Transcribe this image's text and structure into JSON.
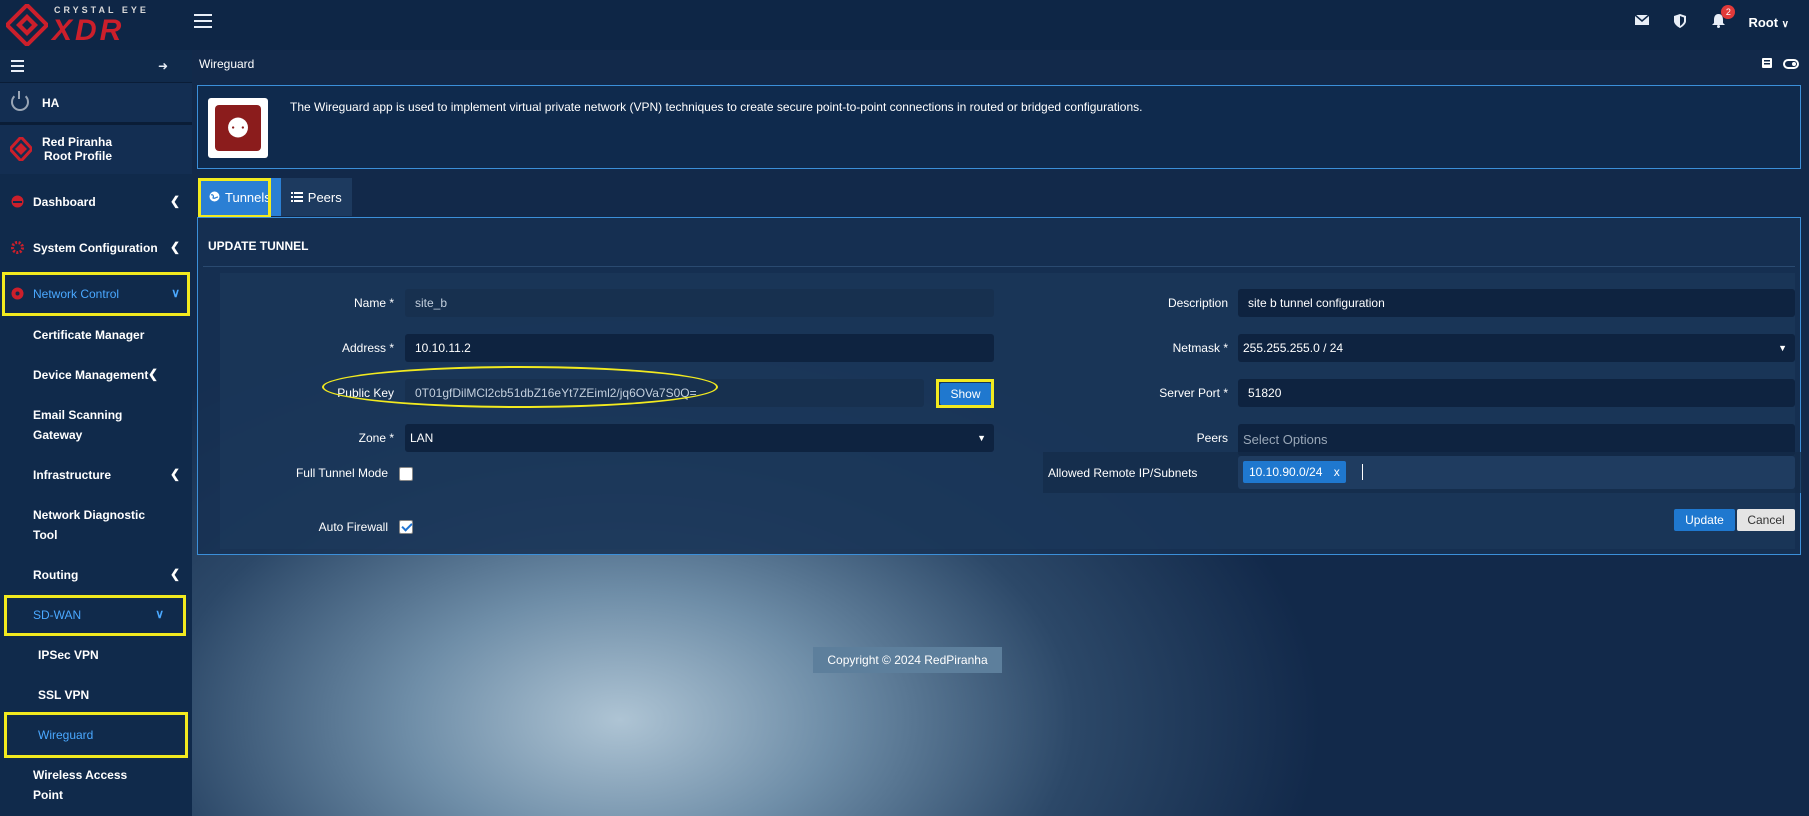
{
  "topbar": {
    "brand_small": "CRYSTAL EYE",
    "brand_big": "XDR",
    "notification_count": "2",
    "user": "Root"
  },
  "sidebar": {
    "ha_label": "HA",
    "profile_name": "Red Piranha",
    "profile_sub": "Root Profile",
    "items": [
      {
        "label": "Dashboard"
      },
      {
        "label": "System Configuration"
      },
      {
        "label": "Network Control"
      }
    ],
    "network_control_sub": [
      {
        "label": "Certificate Manager"
      },
      {
        "label": "Device Management"
      },
      {
        "label": "Email Scanning",
        "label2": "Gateway"
      },
      {
        "label": "Infrastructure"
      },
      {
        "label": "Network Diagnostic",
        "label2": "Tool"
      },
      {
        "label": "Routing"
      }
    ],
    "sdwan_label": "SD-WAN",
    "sdwan_sub": [
      {
        "label": "IPSec VPN"
      },
      {
        "label": "SSL VPN"
      },
      {
        "label": "Wireguard"
      }
    ],
    "wireless_label": "Wireless Access",
    "wireless_label2": "Point"
  },
  "main": {
    "page_title": "Wireguard",
    "info_text": "The Wireguard app is used to implement virtual private network (VPN) techniques to create secure point-to-point connections in routed or bridged configurations.",
    "tabs": [
      {
        "label": "Tunnels"
      },
      {
        "label": "Peers"
      }
    ],
    "panel_title": "UPDATE TUNNEL",
    "form": {
      "name_label": "Name *",
      "name_value": "site_b",
      "address_label": "Address *",
      "address_value": "10.10.11.2",
      "public_key_label": "Public Key",
      "public_key_value": "0T01gfDilMCl2cb51dbZ16eYt7ZEiml2/jq6OVa7S0Q=",
      "show_button": "Show",
      "zone_label": "Zone *",
      "zone_value": "LAN",
      "full_tunnel_label": "Full Tunnel Mode",
      "auto_firewall_label": "Auto Firewall",
      "description_label": "Description",
      "description_value": "site b tunnel configuration",
      "netmask_label": "Netmask *",
      "netmask_value": "255.255.255.0 / 24",
      "server_port_label": "Server Port *",
      "server_port_value": "51820",
      "peers_label": "Peers",
      "peers_placeholder": "Select Options",
      "allowed_label": "Allowed Remote IP/Subnets",
      "allowed_chip": "10.10.90.0/24",
      "chip_remove": "x",
      "update_button": "Update",
      "cancel_button": "Cancel"
    },
    "footer": "Copyright © 2024 RedPiranha"
  },
  "colors": {
    "highlight": "#f2ea1f",
    "accent": "#2b7fd4",
    "brand_red": "#cc1f2b"
  }
}
